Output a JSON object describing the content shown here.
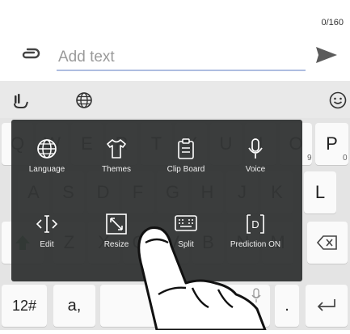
{
  "composer": {
    "char_counter": "0/160",
    "placeholder": "Add text",
    "attach_icon": "paperclip-icon",
    "send_icon": "send-icon"
  },
  "toolbar": {
    "left_icon": "keyboard-settings-icon",
    "globe_icon": "globe-icon",
    "emoji_icon": "emoji-icon"
  },
  "keyboard": {
    "row1": [
      "Q",
      "W",
      "E",
      "R",
      "T",
      "Y",
      "U",
      "I",
      "O",
      "P"
    ],
    "row1_hints": [
      "",
      "",
      "",
      "",
      "",
      "",
      "",
      "",
      "9",
      "0"
    ],
    "row2": [
      "A",
      "S",
      "D",
      "F",
      "G",
      "H",
      "J",
      "K",
      "L"
    ],
    "row3": [
      "Z",
      "X",
      "C",
      "V",
      "B",
      "N",
      "M"
    ],
    "mode_key": "12#",
    "punct_key": "a,",
    "dot_key": ".",
    "colors": {
      "background": "#e4e4e4",
      "key": "#fafafa",
      "panel": "#333535",
      "shift": "#1d8a3a"
    }
  },
  "menu": {
    "items": [
      {
        "label": "Language",
        "icon": "globe-icon"
      },
      {
        "label": "Themes",
        "icon": "shirt-icon"
      },
      {
        "label": "Clip Board",
        "icon": "clipboard-icon"
      },
      {
        "label": "Voice",
        "icon": "microphone-icon"
      },
      {
        "label": "Edit",
        "icon": "cursor-icon"
      },
      {
        "label": "Resize",
        "icon": "resize-icon"
      },
      {
        "label": "Split",
        "icon": "split-keyboard-icon"
      },
      {
        "label": "Prediction ON",
        "icon": "prediction-icon"
      }
    ]
  }
}
